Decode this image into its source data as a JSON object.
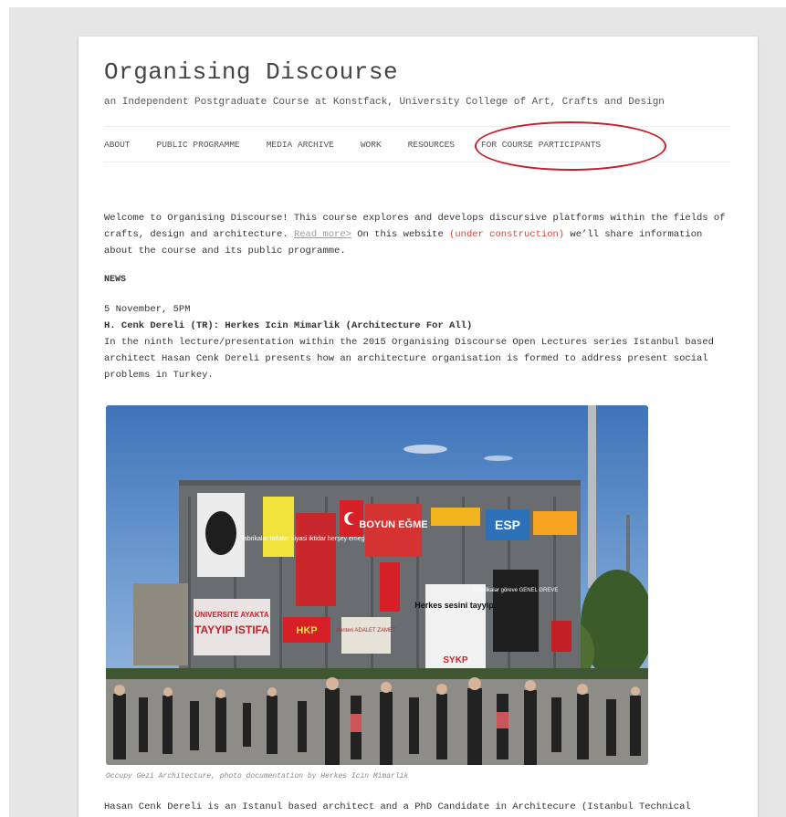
{
  "site": {
    "title": "Organising Discourse",
    "description": "an Independent Postgraduate Course at Konstfack, University College of Art, Crafts and Design"
  },
  "nav": {
    "items": [
      "ABOUT",
      "PUBLIC PROGRAMME",
      "MEDIA ARCHIVE",
      "WORK",
      "RESOURCES",
      "FOR COURSE PARTICIPANTS"
    ]
  },
  "intro": {
    "text_1": "Welcome to Organising Discourse!  This course explores and develops discursive platforms within the fields of crafts, design and architecture. ",
    "read_more": "Read more>",
    "text_2": "  On this website ",
    "under_construction": "(under construction)",
    "text_3": "  we’ll share information about the course and its public programme."
  },
  "news": {
    "heading": "NEWS",
    "date": "5 November, 5PM",
    "title": "H. Cenk Dereli (TR): Herkes Icin Mimarlik (Architecture For All)",
    "body": "In the ninth lecture/presentation within the 2015 Organising Discourse Open Lectures series Istanbul based architect Hasan Cenk Dereli presents how an architecture organisation is formed to address present social problems in Turkey.",
    "photo_caption": "Occupy Gezi Architecture, photo documentation by Herkes Icin Mimarlik",
    "photo_banners": {
      "b1": "ÜNIVERSITE AYAKTA",
      "b2": "TAYYIP ISTIFA",
      "b3": "fabrikalar tarlalar siyasi iktidar herşey emeğin olacak",
      "b4": "BOYUN EĞME",
      "b5": "ESP",
      "b6": "Herkes sesini tayyip!",
      "b7": "Sendikalar göreve GENEL GREVE",
      "b8": "HKP",
      "b9": "SYKP",
      "b10": "Alınteri ADALET ZAMET"
    },
    "tail_text": "Hasan Cenk Dereli is an Istanul based architect and a PhD Candidate in Architecure (Istanbul Technical"
  },
  "colors": {
    "annotation_circle": "#c8202a",
    "highlight_text": "#e0433b"
  }
}
